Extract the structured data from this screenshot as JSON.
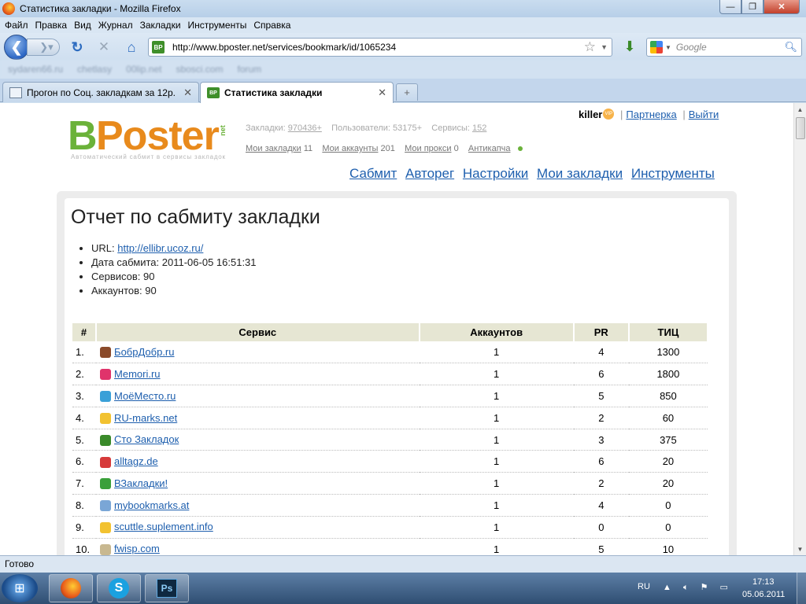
{
  "window": {
    "title": "Статистика закладки - Mozilla Firefox"
  },
  "menu": [
    "Файл",
    "Правка",
    "Вид",
    "Журнал",
    "Закладки",
    "Инструменты",
    "Справка"
  ],
  "nav": {
    "url": "http://www.bposter.net/services/bookmark/id/1065234",
    "search_placeholder": "Google"
  },
  "bookmarks_bar": [
    "sydaren66.ru",
    "chetlasy",
    "00lip.net",
    "sbosci.com",
    "forum"
  ],
  "tabs": [
    {
      "label": "Прогон по Соц. закладкам за 12р.",
      "active": false
    },
    {
      "label": "Статистика закладки",
      "active": true
    }
  ],
  "site": {
    "logo_b": "B",
    "logo_rest": "Poster",
    "logo_net": "net",
    "slogan": "Автоматический сабмит в сервисы закладок",
    "stats": {
      "bookmarks_label": "Закладки:",
      "bookmarks_value": "970436+",
      "users_label": "Пользователи:",
      "users_value": "53175+",
      "services_label": "Сервисы:",
      "services_value": "152"
    },
    "my": {
      "bookmarks_label": "Мои закладки",
      "bookmarks_count": "11",
      "accounts_label": "Мои аккаунты",
      "accounts_count": "201",
      "proxy_label": "Мои прокси",
      "proxy_count": "0",
      "captcha_label": "Антикапча"
    },
    "user": {
      "name": "killer",
      "badge": "VIP",
      "partner": "Партнерка",
      "logout": "Выйти"
    },
    "mainnav": [
      "Сабмит",
      "Авторег",
      "Настройки",
      "Мои закладки",
      "Инструменты"
    ]
  },
  "report": {
    "title": "Отчет по сабмиту закладки",
    "url_label": "URL:",
    "url_value": "http://ellibr.ucoz.ru/",
    "date_label": "Дата сабмита:",
    "date_value": "2011-06-05 16:51:31",
    "services_label": "Сервисов:",
    "services_value": "90",
    "accounts_label": "Аккаунтов:",
    "accounts_value": "90",
    "columns": [
      "#",
      "Сервис",
      "Аккаунтов",
      "PR",
      "ТИЦ"
    ],
    "rows": [
      {
        "n": "1.",
        "service": "БобрДобр.ru",
        "accounts": "1",
        "pr": "4",
        "tic": "1300",
        "icon": "beaver-icon",
        "color": "#8a4a2a"
      },
      {
        "n": "2.",
        "service": "Memori.ru",
        "accounts": "1",
        "pr": "6",
        "tic": "1800",
        "icon": "memori-icon",
        "color": "#e0336b"
      },
      {
        "n": "3.",
        "service": "МоёМесто.ru",
        "accounts": "1",
        "pr": "5",
        "tic": "850",
        "icon": "moemesto-icon",
        "color": "#3aa0d8"
      },
      {
        "n": "4.",
        "service": "RU-marks.net",
        "accounts": "1",
        "pr": "2",
        "tic": "60",
        "icon": "star-icon",
        "color": "#f2c230"
      },
      {
        "n": "5.",
        "service": "Сто Закладок",
        "accounts": "1",
        "pr": "3",
        "tic": "375",
        "icon": "book-icon",
        "color": "#3a8a2a"
      },
      {
        "n": "6.",
        "service": "alltagz.de",
        "accounts": "1",
        "pr": "6",
        "tic": "20",
        "icon": "target-icon",
        "color": "#d63a3a"
      },
      {
        "n": "7.",
        "service": "ВЗакладки!",
        "accounts": "1",
        "pr": "2",
        "tic": "20",
        "icon": "star-icon",
        "color": "#3aa03a"
      },
      {
        "n": "8.",
        "service": "mybookmarks.at",
        "accounts": "1",
        "pr": "4",
        "tic": "0",
        "icon": "dots-icon",
        "color": "#7aa6d6"
      },
      {
        "n": "9.",
        "service": "scuttle.suplement.info",
        "accounts": "1",
        "pr": "0",
        "tic": "0",
        "icon": "star-icon",
        "color": "#f2c230"
      },
      {
        "n": "10.",
        "service": "fwisp.com",
        "accounts": "1",
        "pr": "5",
        "tic": "10",
        "icon": "cloud-icon",
        "color": "#c8b890"
      }
    ]
  },
  "status": "Готово",
  "taskbar": {
    "lang": "RU",
    "time": "17:13",
    "date": "05.06.2011",
    "ps_label": "Ps",
    "skype_label": "S"
  }
}
